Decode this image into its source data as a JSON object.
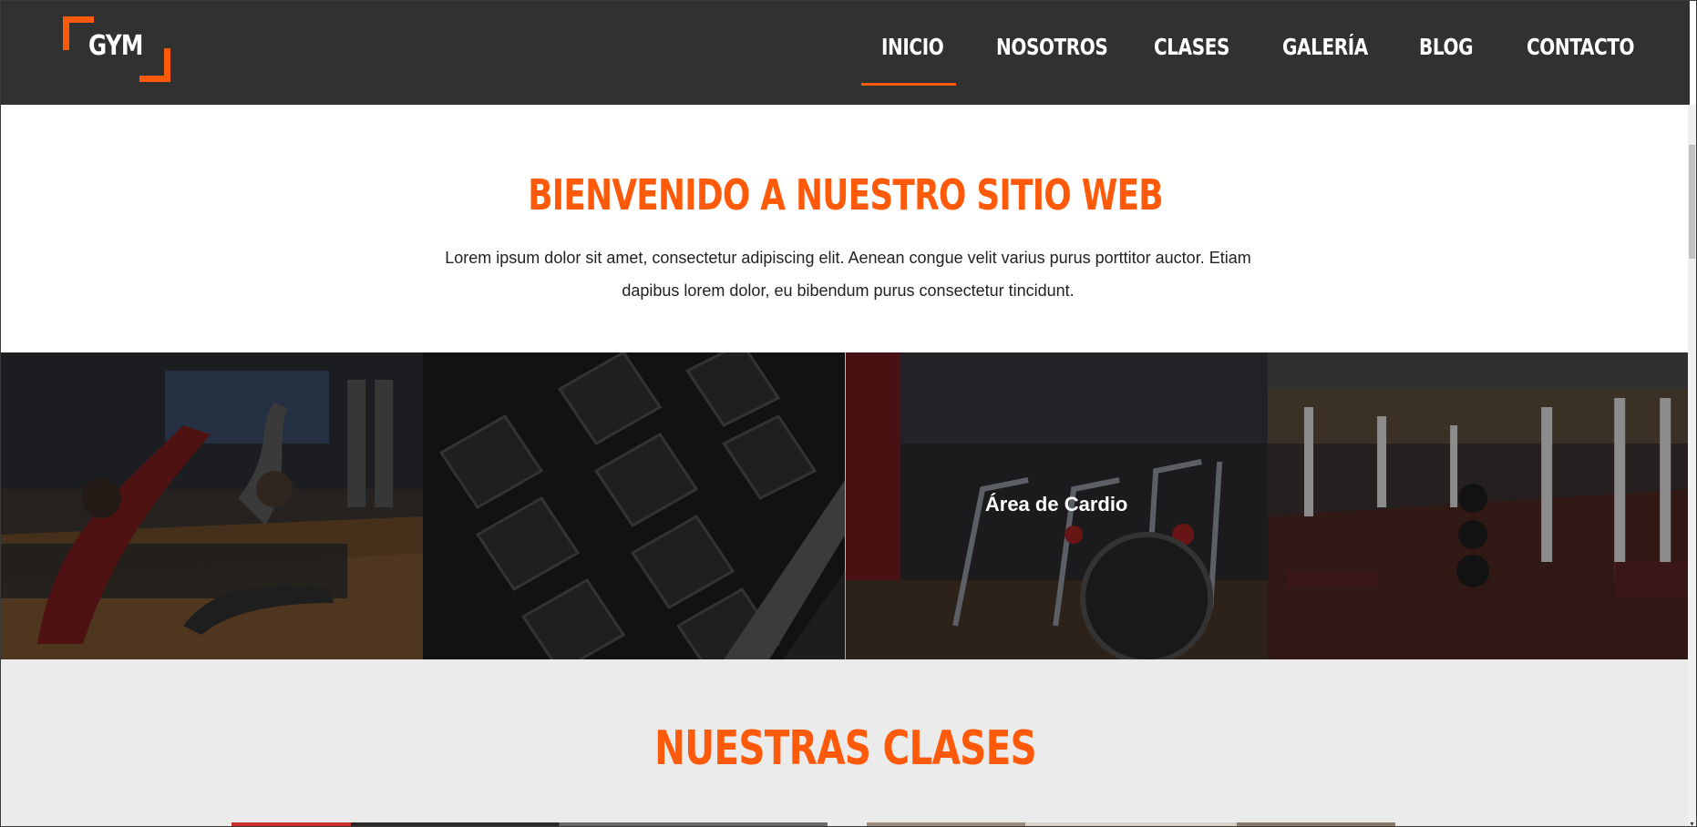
{
  "header": {
    "logo_text": "GYM",
    "nav": [
      {
        "label": "INICIO",
        "active": true
      },
      {
        "label": "NOSOTROS",
        "active": false
      },
      {
        "label": "CLASES",
        "active": false
      },
      {
        "label": "GALERÍA",
        "active": false
      },
      {
        "label": "BLOG",
        "active": false
      },
      {
        "label": "CONTACTO",
        "active": false
      }
    ]
  },
  "welcome": {
    "title": "BIENVENIDO A NUESTRO SITIO WEB",
    "text": "Lorem ipsum dolor sit amet, consectetur adipiscing elit. Aenean congue velit varius purus porttitor auctor. Etiam dapibus lorem dolor, eu bibendum purus consectetur tincidunt."
  },
  "gallery": {
    "tiles": [
      {
        "caption": ""
      },
      {
        "caption": ""
      },
      {
        "caption": "Área de Cardio"
      },
      {
        "caption": ""
      }
    ]
  },
  "classes": {
    "title": "NUESTRAS CLASES"
  },
  "colors": {
    "accent": "#ff5a0a",
    "header_bg": "#313131",
    "classes_bg": "#ebebeb"
  }
}
